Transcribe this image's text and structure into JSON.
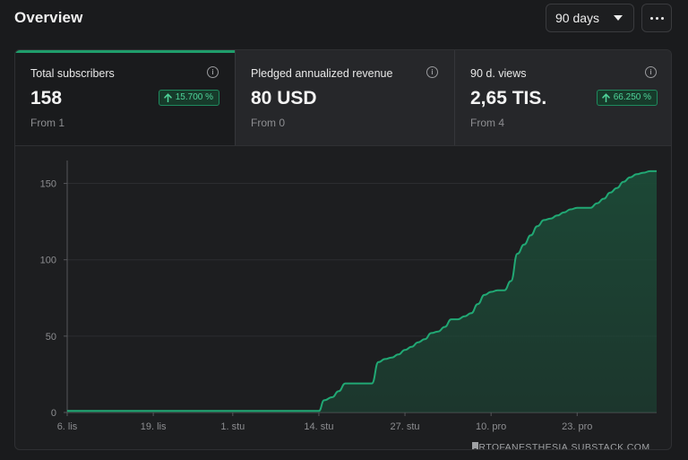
{
  "header": {
    "title": "Overview",
    "range_select": {
      "value": "90 days"
    },
    "more_icon": "more-horizontal-icon"
  },
  "metrics": [
    {
      "label": "Total subscribers",
      "value": "158",
      "sub": "From 1",
      "badge": "15.700 %",
      "active": true
    },
    {
      "label": "Pledged annualized revenue",
      "value": "80 USD",
      "sub": "From 0",
      "badge": "",
      "active": false
    },
    {
      "label": "90 d. views",
      "value": "2,65 TIS.",
      "sub": "From 4",
      "badge": "66.250 %",
      "active": false
    }
  ],
  "icons": {
    "info": "info-icon",
    "badge": "arrow-up-icon",
    "watermark": "bookmark-icon"
  },
  "colors": {
    "accent": "#1f9d6b",
    "line": "#21a874",
    "fill": "#1c4a37",
    "badge_text": "#4fd49a"
  },
  "watermark": "ARTOFANESTHESIA.SUBSTACK.COM",
  "chart_data": {
    "type": "area",
    "title": "",
    "xlabel": "",
    "ylabel": "",
    "ylim": [
      0,
      165
    ],
    "yticks": [
      0,
      50,
      100,
      150
    ],
    "grid": true,
    "x_ticks": [
      "6. lis",
      "19. lis",
      "1. stu",
      "14. stu",
      "27. stu",
      "10. pro",
      "23. pro"
    ],
    "x_tick_days": [
      0,
      13,
      25,
      38,
      51,
      64,
      77
    ],
    "x_range_days": [
      0,
      89
    ],
    "points": [
      [
        0,
        1
      ],
      [
        37,
        1
      ],
      [
        38,
        1
      ],
      [
        38.8,
        8
      ],
      [
        40,
        10
      ],
      [
        41,
        14
      ],
      [
        42,
        19
      ],
      [
        43,
        19
      ],
      [
        46,
        19
      ],
      [
        47,
        33
      ],
      [
        48,
        35
      ],
      [
        49,
        36
      ],
      [
        50,
        38
      ],
      [
        51,
        41
      ],
      [
        52,
        43
      ],
      [
        53,
        46
      ],
      [
        54,
        48
      ],
      [
        55,
        52
      ],
      [
        56,
        53
      ],
      [
        57,
        56
      ],
      [
        58,
        61
      ],
      [
        59,
        61
      ],
      [
        60,
        63
      ],
      [
        61,
        65
      ],
      [
        62,
        71
      ],
      [
        63,
        77
      ],
      [
        64,
        79
      ],
      [
        65,
        80
      ],
      [
        66,
        80
      ],
      [
        67,
        86
      ],
      [
        68,
        104
      ],
      [
        69,
        110
      ],
      [
        70,
        116
      ],
      [
        71,
        122
      ],
      [
        72,
        126
      ],
      [
        73,
        127
      ],
      [
        74,
        129
      ],
      [
        75,
        131
      ],
      [
        76,
        133
      ],
      [
        77,
        134
      ],
      [
        78,
        134
      ],
      [
        79,
        134
      ],
      [
        80,
        137
      ],
      [
        81,
        140
      ],
      [
        82,
        144
      ],
      [
        83,
        147
      ],
      [
        84,
        151
      ],
      [
        85,
        154
      ],
      [
        86,
        156
      ],
      [
        87,
        157
      ],
      [
        88,
        158
      ],
      [
        89,
        158
      ]
    ]
  }
}
